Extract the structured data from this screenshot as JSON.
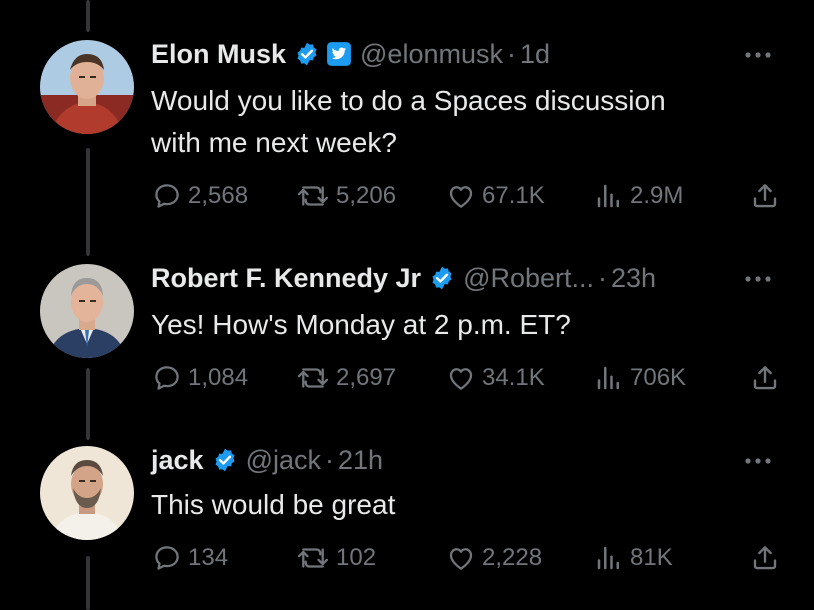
{
  "tweets": [
    {
      "name": "Elon Musk",
      "handle": "@elonmusk",
      "separator": "·",
      "time": "1d",
      "text_lines": [
        "Would you like to do a Spaces discussion",
        "with me next week?"
      ],
      "replies": "2,568",
      "retweets": "5,206",
      "likes": "67.1K",
      "views": "2.9M",
      "badges": [
        "verified-check-icon",
        "twitter-affiliate-badge-icon"
      ]
    },
    {
      "name": "Robert F. Kennedy Jr",
      "handle": "@Robert...",
      "separator": "·",
      "time": "23h",
      "text_lines": [
        "Yes! How's Monday at 2 p.m. ET?"
      ],
      "replies": "1,084",
      "retweets": "2,697",
      "likes": "34.1K",
      "views": "706K",
      "badges": [
        "verified-check-icon"
      ]
    },
    {
      "name": "jack",
      "handle": "@jack",
      "separator": "·",
      "time": "21h",
      "text_lines": [
        "This would be great"
      ],
      "replies": "134",
      "retweets": "102",
      "likes": "2,228",
      "views": "81K",
      "badges": [
        "verified-check-icon"
      ]
    }
  ],
  "colors": {
    "background": "#000000",
    "text_primary": "#e7e9ea",
    "text_secondary": "#71767b",
    "verified_blue": "#1d9bf0",
    "thread_line": "#333639"
  },
  "icons": [
    "reply-icon",
    "retweet-icon",
    "like-icon",
    "views-icon",
    "share-icon",
    "more-icon"
  ]
}
